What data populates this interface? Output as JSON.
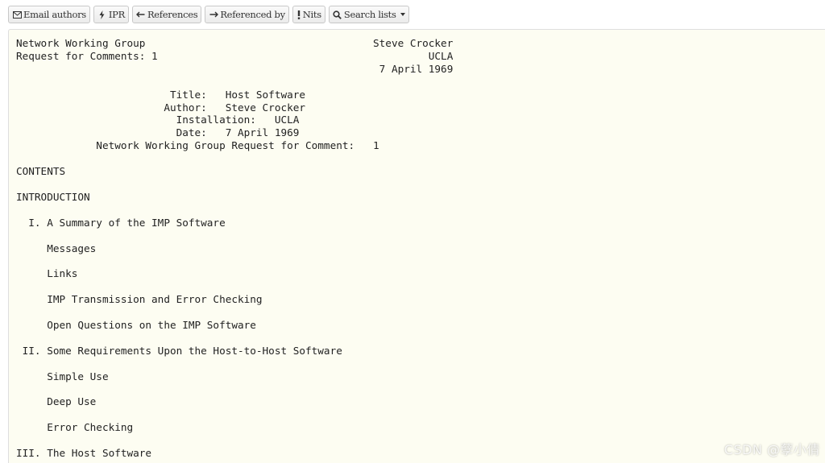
{
  "toolbar": {
    "buttons": [
      {
        "label": "Email authors",
        "icon": "envelope-icon"
      },
      {
        "label": "IPR",
        "icon": "bolt-icon"
      },
      {
        "label": "References",
        "icon": "arrow-left-icon"
      },
      {
        "label": "Referenced by",
        "icon": "arrow-right-icon"
      },
      {
        "label": "Nits",
        "icon": "exclamation-icon"
      },
      {
        "label": "Search lists",
        "icon": "search-icon"
      }
    ]
  },
  "document": {
    "lines": [
      "Network Working Group                                     Steve Crocker",
      "Request for Comments: 1                                            UCLA",
      "                                                           7 April 1969",
      "",
      "                         Title:   Host Software",
      "                        Author:   Steve Crocker",
      "                          Installation:   UCLA",
      "                          Date:   7 April 1969",
      "             Network Working Group Request for Comment:   1",
      "",
      "CONTENTS",
      "",
      "INTRODUCTION",
      "",
      "  I. A Summary of the IMP Software",
      "",
      "     Messages",
      "",
      "     Links",
      "",
      "     IMP Transmission and Error Checking",
      "",
      "     Open Questions on the IMP Software",
      "",
      " II. Some Requirements Upon the Host-to-Host Software",
      "",
      "     Simple Use",
      "",
      "     Deep Use",
      "",
      "     Error Checking",
      "",
      "III. The Host Software"
    ]
  },
  "watermark": "CSDN @孽小倩"
}
